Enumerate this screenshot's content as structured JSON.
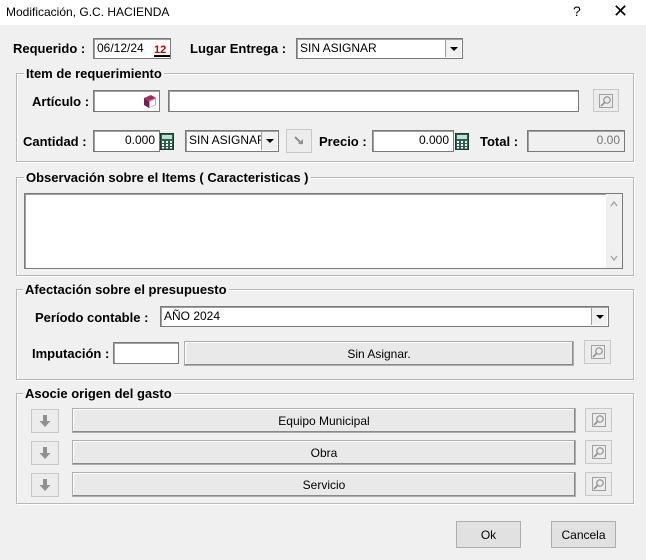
{
  "window": {
    "title": "Modificación, G.C. HACIENDA",
    "help": "?",
    "close": "✕"
  },
  "header": {
    "requerido_label": "Requerido :",
    "requerido_value": "06/12/24",
    "lugar_label": "Lugar Entrega :",
    "lugar_value": "SIN ASIGNAR"
  },
  "item": {
    "legend": "Item de requerimiento",
    "articulo_label": "Artículo :",
    "articulo_code": "",
    "articulo_desc": "",
    "cantidad_label": "Cantidad :",
    "cantidad_value": "0.000",
    "unidad_value": "SIN ASIGNAR",
    "precio_label": "Precio :",
    "precio_value": "0.000",
    "total_label": "Total :",
    "total_value": "0.00"
  },
  "observacion": {
    "legend": "Observación sobre el Items ( Caracteristicas )",
    "text": ""
  },
  "presupuesto": {
    "legend": "Afectación sobre el presupuesto",
    "periodo_label": "Período contable :",
    "periodo_value": "AÑO 2024",
    "imputacion_label": "Imputación :",
    "imputacion_code": "",
    "imputacion_button": "Sin Asignar."
  },
  "origen": {
    "legend": "Asocie origen del gasto",
    "items": [
      {
        "label": "Equipo Municipal"
      },
      {
        "label": "Obra"
      },
      {
        "label": "Servicio"
      }
    ]
  },
  "footer": {
    "ok": "Ok",
    "cancel": "Cancela"
  }
}
